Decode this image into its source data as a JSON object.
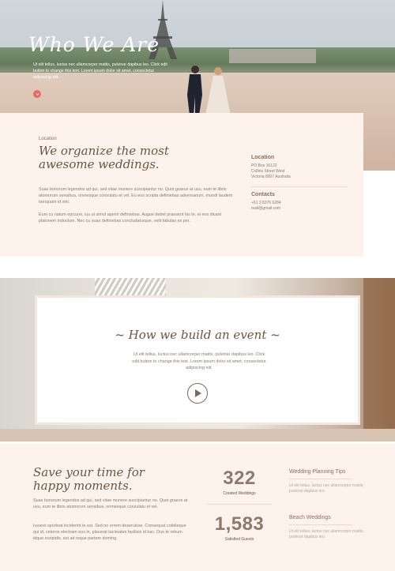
{
  "hero": {
    "title": "Who We Are",
    "text": "Ut elit tellus, luctus nec ullamcorper mattis, pulvinar dapibus leo. Click edit button to change this text. Lorem ipsum dolor sit amet, consectetur adipiscing elit."
  },
  "intro": {
    "eyebrow": "Location",
    "title": "We organize the most awesome weddings.",
    "p1": "Suas bonorum legendos ad qui, sed vitae munere suscipiantur no. Quot graece at usu, eum te libris atomorum sensibus, omnesque consulatu et vel. Eu eos scripta definiebas adversarium, mundi laudem tamquam id vim.",
    "p2": "Eum cu natum epicurei, ius ut simul aperiri definiebas. Augue debet praesent his te, ei eos dicant platonem indoctum. Nec cu suas definiebas concludaturque, velit fabulas ex per.",
    "location_heading": "Location",
    "location_text": "PO Box 16122\nCollins Street West\nVictoria 8007 Australia",
    "contacts_heading": "Contacts",
    "contacts_text": "+61 3 8376 6284\nmail@gmail.com"
  },
  "event": {
    "title": "~ How we build an event ~",
    "text": "Ut elit tellus, luctus nec ullamcorper mattis, pulvinar dapibus leo. Click edit button to change this text. Lorem ipsum dolor sit amet, consectetur adipiscing elit."
  },
  "bottom": {
    "title": "Save your time for happy moments.",
    "p1": "Suas bonorum legendos ad qui, sed vitae munere suscipiantur no. Quot graece at usu, eum te libris atomorum sensibus, omnesque consulatu et vel.",
    "p2": "Iuvaret sporteat inciderint te est. Sed no errem deseruisse. Consequat cotidieque qui id, ceteros electram eos in, placerat tacimates facilisis id hac. Duo te rebum idque euripidis, est ad reque partem doming."
  },
  "stats": [
    {
      "number": "322",
      "label": "Created Weddings"
    },
    {
      "number": "1,583",
      "label": "Satisfied Guests"
    }
  ],
  "posts": [
    {
      "title": "Wedding Planning Tips",
      "text": "Ut elit tellus, luctus nec ullamcorper mattis, pulvinar dapibus leo."
    },
    {
      "title": "Beach Weddings",
      "text": "Ut elit tellus, luctus nec ullamcorper mattis, pulvinar dapibus leo."
    }
  ],
  "icons": {
    "hero_button": "chevron-down-icon",
    "play": "play-icon"
  },
  "colors": {
    "accent": "#e86b63",
    "brand": "#6a5640",
    "panel": "#fdf2ec"
  }
}
